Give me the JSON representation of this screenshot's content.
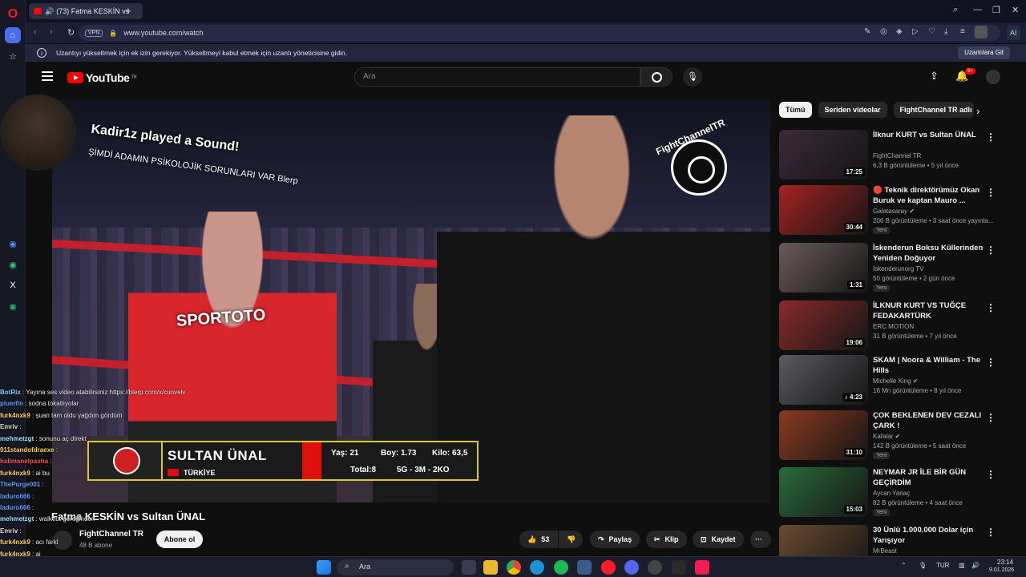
{
  "browser": {
    "tab_title": "(73) Fatma KESKİN vs",
    "url": "www.youtube.com/watch",
    "vpn_label": "VPN",
    "ai_label": "AI",
    "info_text": "Uzantıyı yükseltmek için ek izin gerekiyor. Yükseltmeyi kabul etmek için uzantı yöneticisine gidin.",
    "info_button": "Uzantılara Git"
  },
  "youtube": {
    "logo_text": "YouTube",
    "logo_region": "TR",
    "search_placeholder": "Ara",
    "notif_count": "9+"
  },
  "video": {
    "title": "Fatma KESKİN vs Sultan ÜNAL",
    "overlay_line1": "Kadir1z played a Sound!",
    "overlay_line2": "ŞİMDİ ADAMIN PSİKOLOJİK SORUNLARI VAR Blerp",
    "watermark": "FightChannelTR",
    "sponsor": "SPORTOTO",
    "lower_third": {
      "name": "SULTAN ÜNAL",
      "country": "TÜRKİYE",
      "age": "Yaş: 21",
      "height": "Boy: 1.73",
      "weight": "Kilo: 63,5",
      "total": "Total:8",
      "record": "5G - 3M - 2KO"
    }
  },
  "channel": {
    "name": "FightChannel TR",
    "subs": "48 B abone",
    "subscribe": "Abone ol"
  },
  "actions": {
    "likes": "53",
    "share": "Paylaş",
    "clip": "Klip",
    "save": "Kaydet"
  },
  "chips": [
    "Tümü",
    "Seriden videolar",
    "FightChannel TR adlı"
  ],
  "recs": [
    {
      "title": "İlknur KURT vs Sultan ÜNAL",
      "channel": "FightChannel TR",
      "meta": "6,3 B görüntüleme • 5 yıl önce",
      "dur": "17:25",
      "new": "",
      "color": "#3a2a3a"
    },
    {
      "title": "🔴 Teknik direktörümüz Okan Buruk ve kaptan Mauro ...",
      "channel": "Galatasaray ✔",
      "meta": "206 B görüntüleme • 3 saat önce yayınla...",
      "dur": "30:44",
      "new": "Yeni",
      "color": "#a52222"
    },
    {
      "title": "İskenderun Boksu Küllerinden Yeniden Doğuyor",
      "channel": "İskenderunorg TV",
      "meta": "50 görüntüleme • 2 gün önce",
      "dur": "1:31",
      "new": "Yeni",
      "color": "#6a5a5a"
    },
    {
      "title": "İLKNUR KURT VS TUĞÇE FEDAKARTÜRK",
      "channel": "ERC MOTION",
      "meta": "31 B görüntüleme • 7 yıl önce",
      "dur": "19:06",
      "new": "",
      "color": "#8a2a2a"
    },
    {
      "title": "SKAM | Noora & William - The Hills",
      "channel": "Michelle King ✔",
      "meta": "16 Mn görüntüleme • 8 yıl önce",
      "dur": "♪ 4:23",
      "new": "",
      "color": "#5a5a60"
    },
    {
      "title": "ÇOK BEKLENEN DEV CEZALI ÇARK !",
      "channel": "Kafalar ✔",
      "meta": "142 B görüntüleme • 5 saat önce",
      "dur": "31:10",
      "new": "Yeni",
      "color": "#8a3a20"
    },
    {
      "title": "NEYMAR JR İLE BİR GÜN GEÇİRDİM",
      "channel": "Aycan Yanaç",
      "meta": "82 B görüntüleme • 4 saat önce",
      "dur": "15:03",
      "new": "Yeni",
      "color": "#2a6a3a"
    },
    {
      "title": "30 Ünlü 1.000.000 Dolar için Yarışıyor",
      "channel": "MrBeast",
      "meta": "",
      "dur": "",
      "new": "",
      "color": "#6a4a30"
    }
  ],
  "chat": [
    {
      "user": "BotRix",
      "text": " : Yayına ses video atabilirsiniz https://blerp.com/x/cunvelv",
      "color": "#7fd0ff"
    },
    {
      "user": "pluer0n",
      "text": " : sodna tokatlıyolar",
      "color": "#5aa0ff"
    },
    {
      "user": "furk4nxk9",
      "text": " : şuan tam oldu yağdım gördüm",
      "color": "#ffd060"
    },
    {
      "user": "Emriv",
      "text": " :",
      "color": "#dddddd"
    },
    {
      "user": "mehmetzgt",
      "text": " : sonunu aç direkt",
      "color": "#9fe0ff"
    },
    {
      "user": "911standofdraexe",
      "text": " :",
      "color": "#ffd060"
    },
    {
      "user": "halimanelpasha",
      "text": " :",
      "color": "#ff5050"
    },
    {
      "user": "furk4nxk9",
      "text": " : ai bu",
      "color": "#ffd060"
    },
    {
      "user": "ThePurge001",
      "text": " :",
      "color": "#5aa0ff"
    },
    {
      "user": "laduro666",
      "text": " :",
      "color": "#5aa0ff"
    },
    {
      "user": "laduro666",
      "text": " :",
      "color": "#5aa0ff"
    },
    {
      "user": "mehmetzgt",
      "text": " : walkout gereğinden",
      "color": "#9fe0ff"
    },
    {
      "user": "Emriv",
      "text": " :",
      "color": "#dddddd"
    },
    {
      "user": "furk4nxk9",
      "text": " : acı farkl",
      "color": "#ffd060"
    },
    {
      "user": "furk4nxk9",
      "text": " : ai",
      "color": "#ffd060"
    }
  ],
  "taskbar": {
    "search": "Ara",
    "lang": "TUR",
    "time": "23:14",
    "date": "9.01.2026"
  }
}
